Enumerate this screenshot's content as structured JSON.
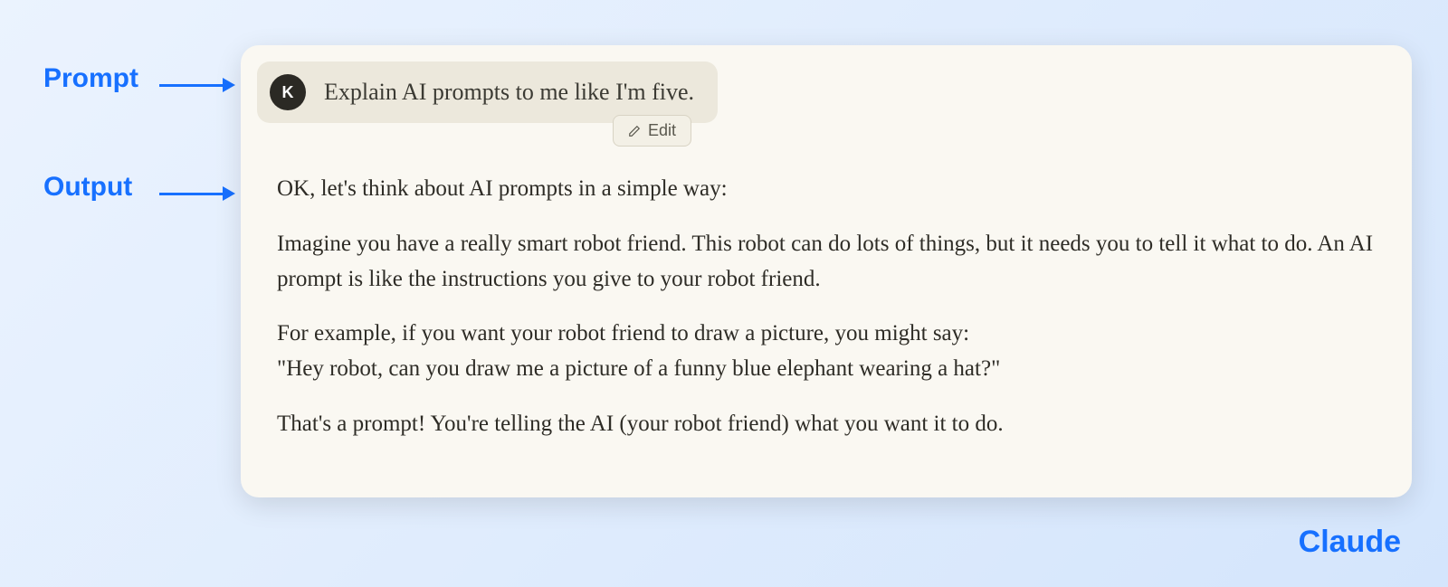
{
  "labels": {
    "prompt": "Prompt",
    "output": "Output"
  },
  "chat": {
    "avatar_letter": "K",
    "prompt_text": "Explain AI prompts to me like I'm five.",
    "edit_label": "Edit",
    "output_paragraphs": {
      "p1": "OK, let's think about AI prompts in a simple way:",
      "p2": "Imagine you have a really smart robot friend. This robot can do lots of things, but it needs you to tell it what to do. An AI prompt is like the instructions you give to your robot friend.",
      "p3": "For example, if you want your robot friend to draw a picture, you might say:\n\"Hey robot, can you draw me a picture of a funny blue elephant wearing a hat?\"",
      "p4": "That's a prompt! You're telling the AI (your robot friend) what you want it to do."
    }
  },
  "brand": "Claude"
}
